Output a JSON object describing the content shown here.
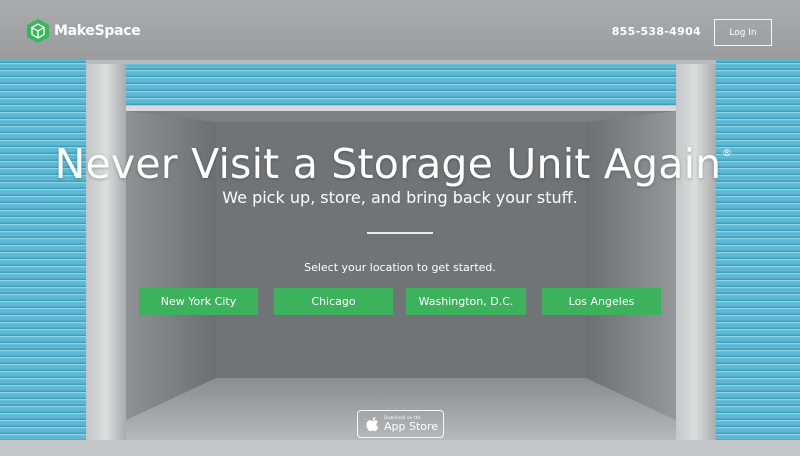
{
  "header": {
    "brand": "MakeSpace",
    "phone": "855-538-4904",
    "login_label": "Log In"
  },
  "hero": {
    "headline": "Never Visit a Storage Unit Again",
    "trademark": "®",
    "subheadline": "We pick up, store, and bring back your stuff.",
    "prompt": "Select your location to get started."
  },
  "cities": [
    {
      "label": "New York City"
    },
    {
      "label": "Chicago"
    },
    {
      "label": "Washington, D.C."
    },
    {
      "label": "Los Angeles"
    }
  ],
  "app_store": {
    "small_text": "Download on the",
    "big_text": "App Store",
    "icon": "apple-icon"
  },
  "colors": {
    "accent_green": "#3cb25c",
    "brand_green": "#39b55e",
    "shutter_blue": "#5bb8d2"
  }
}
